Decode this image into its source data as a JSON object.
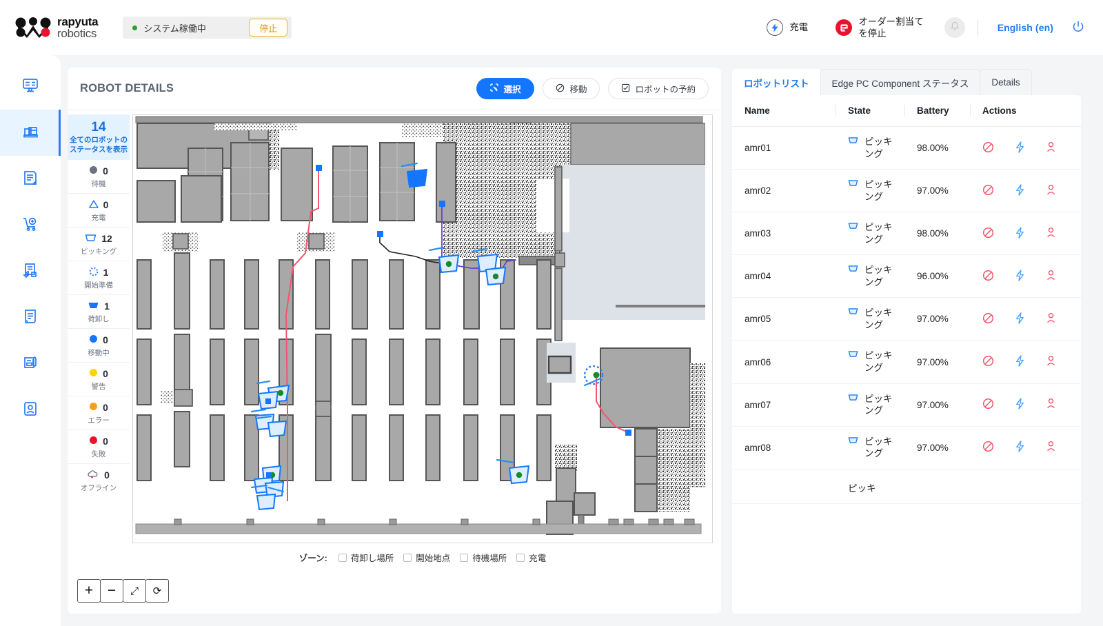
{
  "brand": {
    "line1": "rapyuta",
    "line2": "robotics"
  },
  "header": {
    "system_status_label": "システム稼働中",
    "stop_button": "停止",
    "charge_label": "充電",
    "order_stop_label_1": "オーダー割当て",
    "order_stop_label_2": "を停止",
    "language": "English (en)",
    "icons": {
      "charge": "charge-bolt-icon",
      "order": "order-stop-icon",
      "bell": "bell-icon",
      "power": "power-icon"
    }
  },
  "sidebar": {
    "items": [
      {
        "name": "dashboard",
        "icon": "dashboard-icon",
        "active": false
      },
      {
        "name": "robots",
        "icon": "robot-fleet-icon",
        "active": true
      },
      {
        "name": "orders-edit",
        "icon": "note-edit-icon",
        "active": false
      },
      {
        "name": "new-order",
        "icon": "cart-plus-icon",
        "active": false
      },
      {
        "name": "returns",
        "icon": "doc-return-icon",
        "active": false
      },
      {
        "name": "reports",
        "icon": "document-icon",
        "active": false
      },
      {
        "name": "attachments",
        "icon": "doc-clip-icon",
        "active": false
      },
      {
        "name": "users",
        "icon": "user-card-icon",
        "active": false
      }
    ]
  },
  "map_panel": {
    "title": "ROBOT DETAILS",
    "buttons": {
      "select": "選択",
      "move": "移動",
      "reserve": "ロボットの予約"
    },
    "zone_label": "ゾーン:",
    "zones": [
      {
        "label": "荷卸し場所",
        "checked": false
      },
      {
        "label": "開始地点",
        "checked": false
      },
      {
        "label": "待機場所",
        "checked": false
      },
      {
        "label": "充電",
        "checked": false
      }
    ],
    "tools": [
      {
        "name": "zoom-in",
        "glyph": "+"
      },
      {
        "name": "zoom-out",
        "glyph": "−"
      },
      {
        "name": "fit-screen",
        "glyph": "⤢"
      },
      {
        "name": "reset",
        "glyph": "⟳"
      }
    ]
  },
  "status_summary": {
    "all": {
      "count": "14",
      "label_1": "全てのロボットの",
      "label_2": "ステータスを表示"
    },
    "rows": [
      {
        "count": "0",
        "label": "待機",
        "icon": "circle-gray",
        "color": "#6b7280"
      },
      {
        "count": "0",
        "label": "充電",
        "icon": "triangle-blue",
        "color": "#1d7bf2"
      },
      {
        "count": "12",
        "label": "ピッキング",
        "icon": "bin-outline",
        "color": "#1d7bf2"
      },
      {
        "count": "1",
        "label": "開始準備",
        "icon": "dotted-circle",
        "color": "#1d7bf2"
      },
      {
        "count": "1",
        "label": "荷卸し",
        "icon": "bin-filled",
        "color": "#1476ff"
      },
      {
        "count": "0",
        "label": "移動中",
        "icon": "circle-blue",
        "color": "#1476ff"
      },
      {
        "count": "0",
        "label": "警告",
        "icon": "circle-yellow",
        "color": "#ffd400"
      },
      {
        "count": "0",
        "label": "エラー",
        "icon": "circle-orange",
        "color": "#f59f1a"
      },
      {
        "count": "0",
        "label": "失敗",
        "icon": "circle-red",
        "color": "#e8142d"
      },
      {
        "count": "0",
        "label": "オフライン",
        "icon": "cloud-off",
        "color": "#6b7280"
      }
    ]
  },
  "right_panel": {
    "tabs": [
      {
        "label": "ロボットリスト",
        "active": true
      },
      {
        "label": "Edge PC Component ステータス",
        "active": false
      },
      {
        "label": "Details",
        "active": false
      }
    ],
    "columns": [
      "Name",
      "State",
      "Battery",
      "Actions"
    ],
    "rows": [
      {
        "name": "amr01",
        "state": "ピッキング",
        "battery": "98.00%"
      },
      {
        "name": "amr02",
        "state": "ピッキング",
        "battery": "97.00%"
      },
      {
        "name": "amr03",
        "state": "ピッキング",
        "battery": "98.00%"
      },
      {
        "name": "amr04",
        "state": "ピッキング",
        "battery": "96.00%"
      },
      {
        "name": "amr05",
        "state": "ピッキング",
        "battery": "97.00%"
      },
      {
        "name": "amr06",
        "state": "ピッキング",
        "battery": "97.00%"
      },
      {
        "name": "amr07",
        "state": "ピッキング",
        "battery": "97.00%"
      },
      {
        "name": "amr08",
        "state": "ピッキング",
        "battery": "97.00%"
      }
    ],
    "partial_row_state": "ピッキ",
    "action_icons": [
      "block-icon",
      "charge-bolt-icon",
      "person-icon"
    ]
  },
  "colors": {
    "accent_blue": "#1476ff",
    "link_blue": "#1d7bf2",
    "warning_amber": "#f0b429",
    "danger_red": "#e8142d",
    "robot_green": "#1a8a24"
  }
}
